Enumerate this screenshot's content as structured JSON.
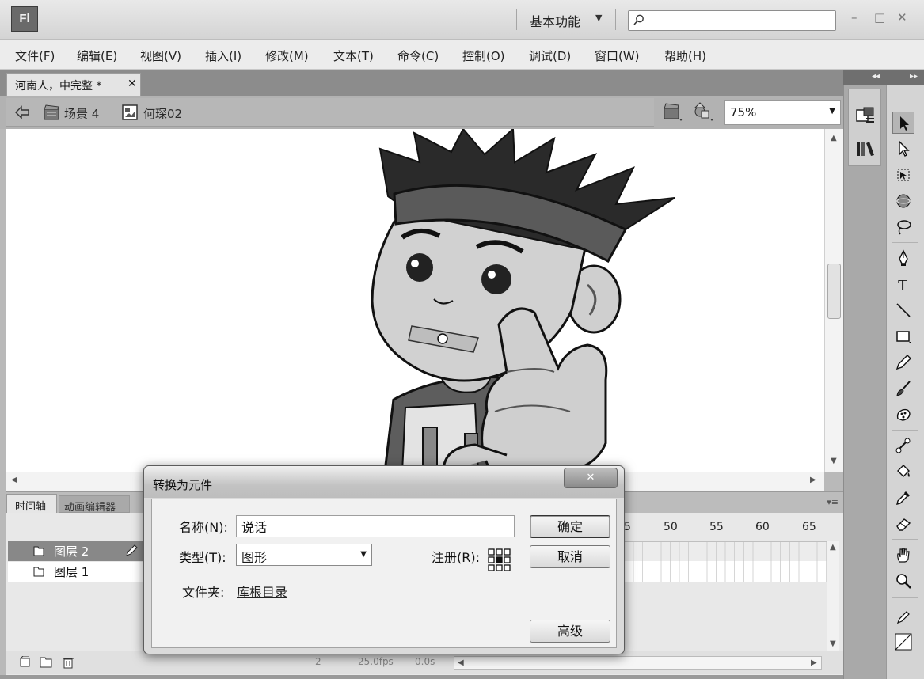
{
  "app": {
    "logo": "Fl",
    "workspace": "基本功能",
    "search_placeholder": "",
    "window_controls": [
      "–",
      "□",
      "✕"
    ]
  },
  "menu": [
    "文件(F)",
    "编辑(E)",
    "视图(V)",
    "插入(I)",
    "修改(M)",
    "文本(T)",
    "命令(C)",
    "控制(O)",
    "调试(D)",
    "窗口(W)",
    "帮助(H)"
  ],
  "document": {
    "tab_label": "河南人，中完整 *",
    "tab_close": "✕"
  },
  "editbar": {
    "scene": "场景 4",
    "symbol": "何琛02",
    "zoom": "75%"
  },
  "timeline": {
    "tab_timeline": "时间轴",
    "tab_motion": "动画编辑器",
    "layers": [
      {
        "name": "图层 2",
        "selected": true
      },
      {
        "name": "图层 1",
        "selected": false
      }
    ],
    "frame_numbers": [
      "50",
      "55",
      "60",
      "65"
    ],
    "frame_partial": "5",
    "status_frame": "2",
    "status_fps": "25.0fps",
    "status_time": "0.0s"
  },
  "dialog": {
    "title": "转换为元件",
    "close": "✕",
    "name_label": "名称(N):",
    "name_value": "说话",
    "type_label": "类型(T):",
    "type_value": "图形",
    "registration_label": "注册(R):",
    "folder_label": "文件夹:",
    "folder_value": "库根目录",
    "ok": "确定",
    "cancel": "取消",
    "advanced": "高级"
  },
  "icons": {
    "selection_tool": "arrow-icon",
    "subselection_tool": "subselect-arrow-icon",
    "free_transform": "free-transform-icon",
    "3d_rotation": "3d-rotation-icon",
    "lasso": "lasso-icon",
    "pen": "pen-icon",
    "text": "text-tool-icon",
    "line": "line-tool-icon",
    "rectangle": "rectangle-tool-icon",
    "pencil": "pencil-tool-icon",
    "brush": "brush-tool-icon",
    "deco": "deco-tool-icon",
    "bone": "bone-tool-icon",
    "paint_bucket": "paint-bucket-icon",
    "eyedropper": "eyedropper-icon",
    "eraser": "eraser-icon",
    "hand": "hand-icon",
    "zoom": "zoom-icon"
  }
}
